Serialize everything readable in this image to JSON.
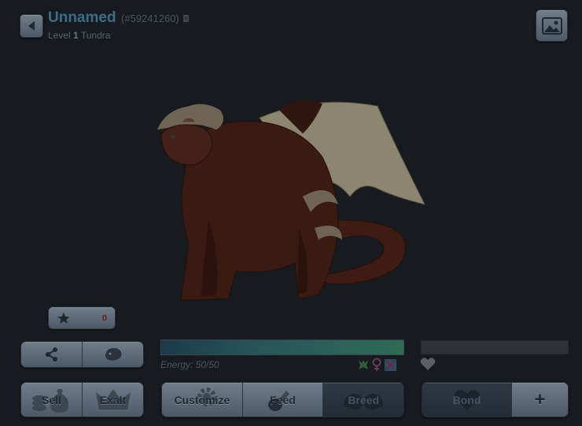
{
  "header": {
    "dragon_name": "Unnamed",
    "dragon_id": "(#59241260)",
    "level_label": "Level",
    "level_value": "1",
    "breed": "Tundra"
  },
  "icons": {
    "back": "back-arrow-icon",
    "scene": "picture-frame-icon",
    "favorite": "star-icon",
    "share": "share-icon",
    "dragon_head": "dragon-head-icon",
    "bond_heart": "heart-icon",
    "plus": "plus-icon"
  },
  "favorite": {
    "count": "0"
  },
  "energy": {
    "label": "Energy: 50/50",
    "fraction": 1.0
  },
  "actions": {
    "sell": "Sell",
    "exalt": "Exalt",
    "customize": "Customize",
    "feed": "Feed",
    "breed": "Breed",
    "bond": "Bond",
    "plus": "+"
  },
  "colors": {
    "title": "#3c6e8a",
    "background": "#171a1e",
    "button": "#5d6a77",
    "energy_start": "#1d3a4a",
    "energy_end": "#2f6b55"
  }
}
